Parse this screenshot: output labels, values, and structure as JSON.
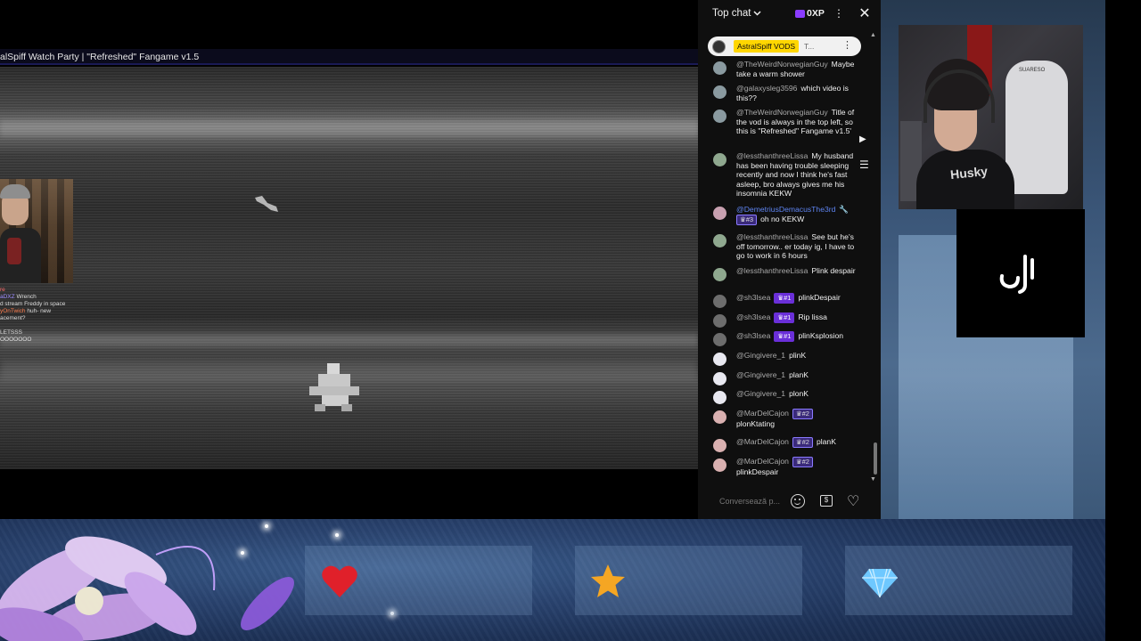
{
  "video": {
    "title": "alSpiff Watch Party | \"Refreshed\" Fangame v1.5",
    "inner_chat": [
      {
        "name": "re",
        "text": "",
        "cls": "n1"
      },
      {
        "name": "aDXZ",
        "text": "Wrench",
        "cls": "n2"
      },
      {
        "name": "",
        "text": "d stream Freddy in space",
        "cls": ""
      },
      {
        "name": "yOnTwich",
        "text": "huh- new",
        "cls": "n3"
      },
      {
        "name": "",
        "text": "acement?",
        "cls": ""
      },
      {
        "name": "",
        "text": "LETSSS",
        "cls": ""
      },
      {
        "name": "",
        "text": "OOOOOOO",
        "cls": ""
      }
    ]
  },
  "chat": {
    "header": {
      "mode_label": "Top chat",
      "xp_label": "0XP",
      "more_icon": "more-vert-icon",
      "close_icon": "close-icon"
    },
    "pinned": {
      "name": "AstralSpiff VODS",
      "text": "T..."
    },
    "messages": [
      {
        "author": "@TheWeirdNorwegianGuy",
        "badge": "",
        "badge_type": "",
        "text": "Maybe take a warm shower",
        "mod": false
      },
      {
        "author": "@galaxysleg3596",
        "badge": "",
        "badge_type": "",
        "text": "which video is this??",
        "mod": false
      },
      {
        "author": "@TheWeirdNorwegianGuy",
        "badge": "",
        "badge_type": "",
        "text": "Title of the vod is always in the top left, so this is \"Refreshed\" Fangame v1.5'",
        "mod": false
      },
      {
        "author": "@lessthanthreeLissa",
        "badge": "",
        "badge_type": "",
        "text": "My husband has been having trouble sleeping recently and now I think he's fast asleep, bro always gives me his insomnia KEKW",
        "mod": false
      },
      {
        "author": "@DemetriusDemacusThe3rd",
        "badge": "#3",
        "badge_type": "outline",
        "text": "oh no KEKW",
        "mod": true
      },
      {
        "author": "@lessthanthreeLissa",
        "badge": "",
        "badge_type": "",
        "text": "See but he's off tomorrow.. er today ig, I have to go to work in 6 hours",
        "mod": false
      },
      {
        "author": "@lessthanthreeLissa",
        "badge": "",
        "badge_type": "",
        "text": "Plink despair",
        "mod": false
      },
      {
        "author": "@sh3lsea",
        "badge": "#1",
        "badge_type": "purple",
        "text": "plinkDespair",
        "mod": false
      },
      {
        "author": "@sh3lsea",
        "badge": "#1",
        "badge_type": "purple",
        "text": "Rip lissa",
        "mod": false
      },
      {
        "author": "@sh3lsea",
        "badge": "#1",
        "badge_type": "purple",
        "text": "plinKsplosion",
        "mod": false
      },
      {
        "author": "@Gingivere_1",
        "badge": "",
        "badge_type": "",
        "text": "plinK",
        "mod": false
      },
      {
        "author": "@Gingivere_1",
        "badge": "",
        "badge_type": "",
        "text": "planK",
        "mod": false
      },
      {
        "author": "@Gingivere_1",
        "badge": "",
        "badge_type": "",
        "text": "plonK",
        "mod": false
      },
      {
        "author": "@MarDelCajon",
        "badge": "#2",
        "badge_type": "outline",
        "text": "plonKtating",
        "mod": false
      },
      {
        "author": "@MarDelCajon",
        "badge": "#2",
        "badge_type": "outline",
        "text": "planK",
        "mod": false
      },
      {
        "author": "@MarDelCajon",
        "badge": "#2",
        "badge_type": "outline",
        "text": "plinkDespair",
        "mod": false
      }
    ],
    "input_placeholder": "Conversează p...",
    "footer_icons": [
      "emoji-icon",
      "superchat-icon",
      "heart-icon"
    ]
  },
  "webcam": {
    "hoodie_text": "Husky",
    "chair_logo": "SUARESO"
  },
  "overlay": {
    "stats": [
      {
        "icon": "heart-icon",
        "color": "#e0202a",
        "value": ""
      },
      {
        "icon": "star-icon",
        "color": "#f5a623",
        "value": ""
      },
      {
        "icon": "diamond-icon",
        "color": "#6ec8ff",
        "value": ""
      }
    ]
  }
}
